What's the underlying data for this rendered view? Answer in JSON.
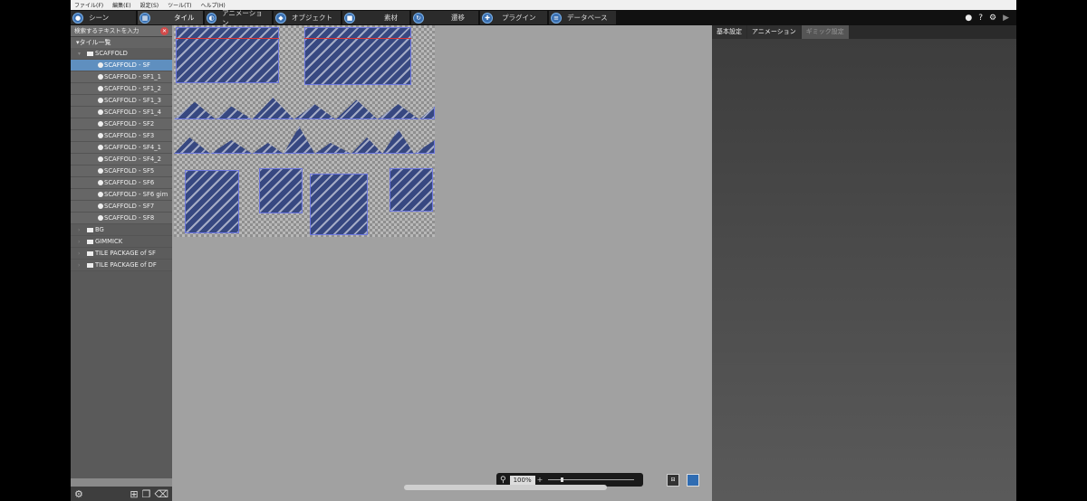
{
  "menu": [
    "ファイル(F)",
    "編集(E)",
    "設定(S)",
    "ツール(T)",
    "ヘルプ(H)"
  ],
  "tabs": [
    {
      "label": "シーン",
      "icon": "scene-icon",
      "active": false
    },
    {
      "label": "タイル",
      "icon": "tile-icon",
      "active": true
    },
    {
      "label": "アニメーション",
      "icon": "animation-icon",
      "active": false
    },
    {
      "label": "オブジェクト",
      "icon": "object-icon",
      "active": false
    },
    {
      "label": "素材",
      "icon": "material-icon",
      "active": false
    },
    {
      "label": "遷移",
      "icon": "transition-icon",
      "active": false
    },
    {
      "label": "プラグイン",
      "icon": "plugin-icon",
      "active": false
    },
    {
      "label": "データベース",
      "icon": "database-icon",
      "active": false
    }
  ],
  "toolbar_right": {
    "help": "?",
    "play": "▶"
  },
  "sidebar": {
    "search_placeholder": "検索するテキストを入力",
    "header": "タイル一覧",
    "items": [
      {
        "label": "SCAFFOLD",
        "kind": "folder",
        "expanded": true
      },
      {
        "label": "SCAFFOLD - SF",
        "kind": "tile",
        "selected": true
      },
      {
        "label": "SCAFFOLD - SF1_1",
        "kind": "tile"
      },
      {
        "label": "SCAFFOLD - SF1_2",
        "kind": "tile"
      },
      {
        "label": "SCAFFOLD - SF1_3",
        "kind": "tile"
      },
      {
        "label": "SCAFFOLD - SF1_4",
        "kind": "tile"
      },
      {
        "label": "SCAFFOLD - SF2",
        "kind": "tile"
      },
      {
        "label": "SCAFFOLD - SF3",
        "kind": "tile"
      },
      {
        "label": "SCAFFOLD - SF4_1",
        "kind": "tile"
      },
      {
        "label": "SCAFFOLD - SF4_2",
        "kind": "tile"
      },
      {
        "label": "SCAFFOLD - SF5",
        "kind": "tile"
      },
      {
        "label": "SCAFFOLD - SF6",
        "kind": "tile"
      },
      {
        "label": "SCAFFOLD - SF6 gim",
        "kind": "tile"
      },
      {
        "label": "SCAFFOLD - SF7",
        "kind": "tile"
      },
      {
        "label": "SCAFFOLD - SF8",
        "kind": "tile"
      },
      {
        "label": "BG",
        "kind": "folder",
        "expanded": false
      },
      {
        "label": "GIMMICK",
        "kind": "folder",
        "expanded": false
      },
      {
        "label": "TILE PACKAGE of SF",
        "kind": "folder",
        "expanded": false
      },
      {
        "label": "TILE PACKAGE of DF",
        "kind": "folder",
        "expanded": false
      }
    ]
  },
  "zoom": {
    "value": "100%",
    "plus": "+"
  },
  "right_tabs": [
    {
      "label": "基本設定",
      "active": true
    },
    {
      "label": "アニメーション",
      "active": false
    },
    {
      "label": "ギミック設定",
      "active": false,
      "disabled": true
    }
  ],
  "colors": {
    "accent": "#3a6fb0",
    "selected_row": "#5f8fbf",
    "tile_outline": "#6f79e0",
    "color_swatch": "#2f6cb2"
  }
}
